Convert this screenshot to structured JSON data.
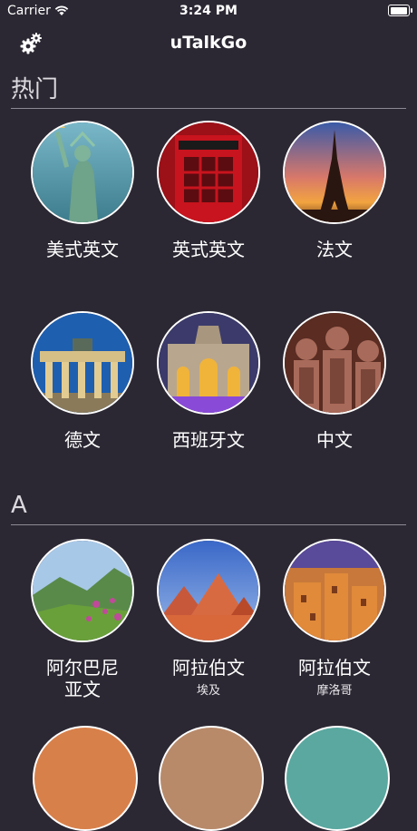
{
  "status": {
    "carrier": "Carrier",
    "time": "3:24 PM"
  },
  "nav": {
    "title": "uTalkGo"
  },
  "sections": [
    {
      "header": "热门"
    },
    {
      "header": "A"
    }
  ],
  "popular": [
    {
      "label": "美式英文"
    },
    {
      "label": "英式英文"
    },
    {
      "label": "法文"
    },
    {
      "label": "德文"
    },
    {
      "label": "西班牙文"
    },
    {
      "label": "中文"
    }
  ],
  "section_a": [
    {
      "label": "阿尔巴尼\n亚文",
      "sub": ""
    },
    {
      "label": "阿拉伯文",
      "sub": "埃及"
    },
    {
      "label": "阿拉伯文",
      "sub": "摩洛哥"
    }
  ]
}
